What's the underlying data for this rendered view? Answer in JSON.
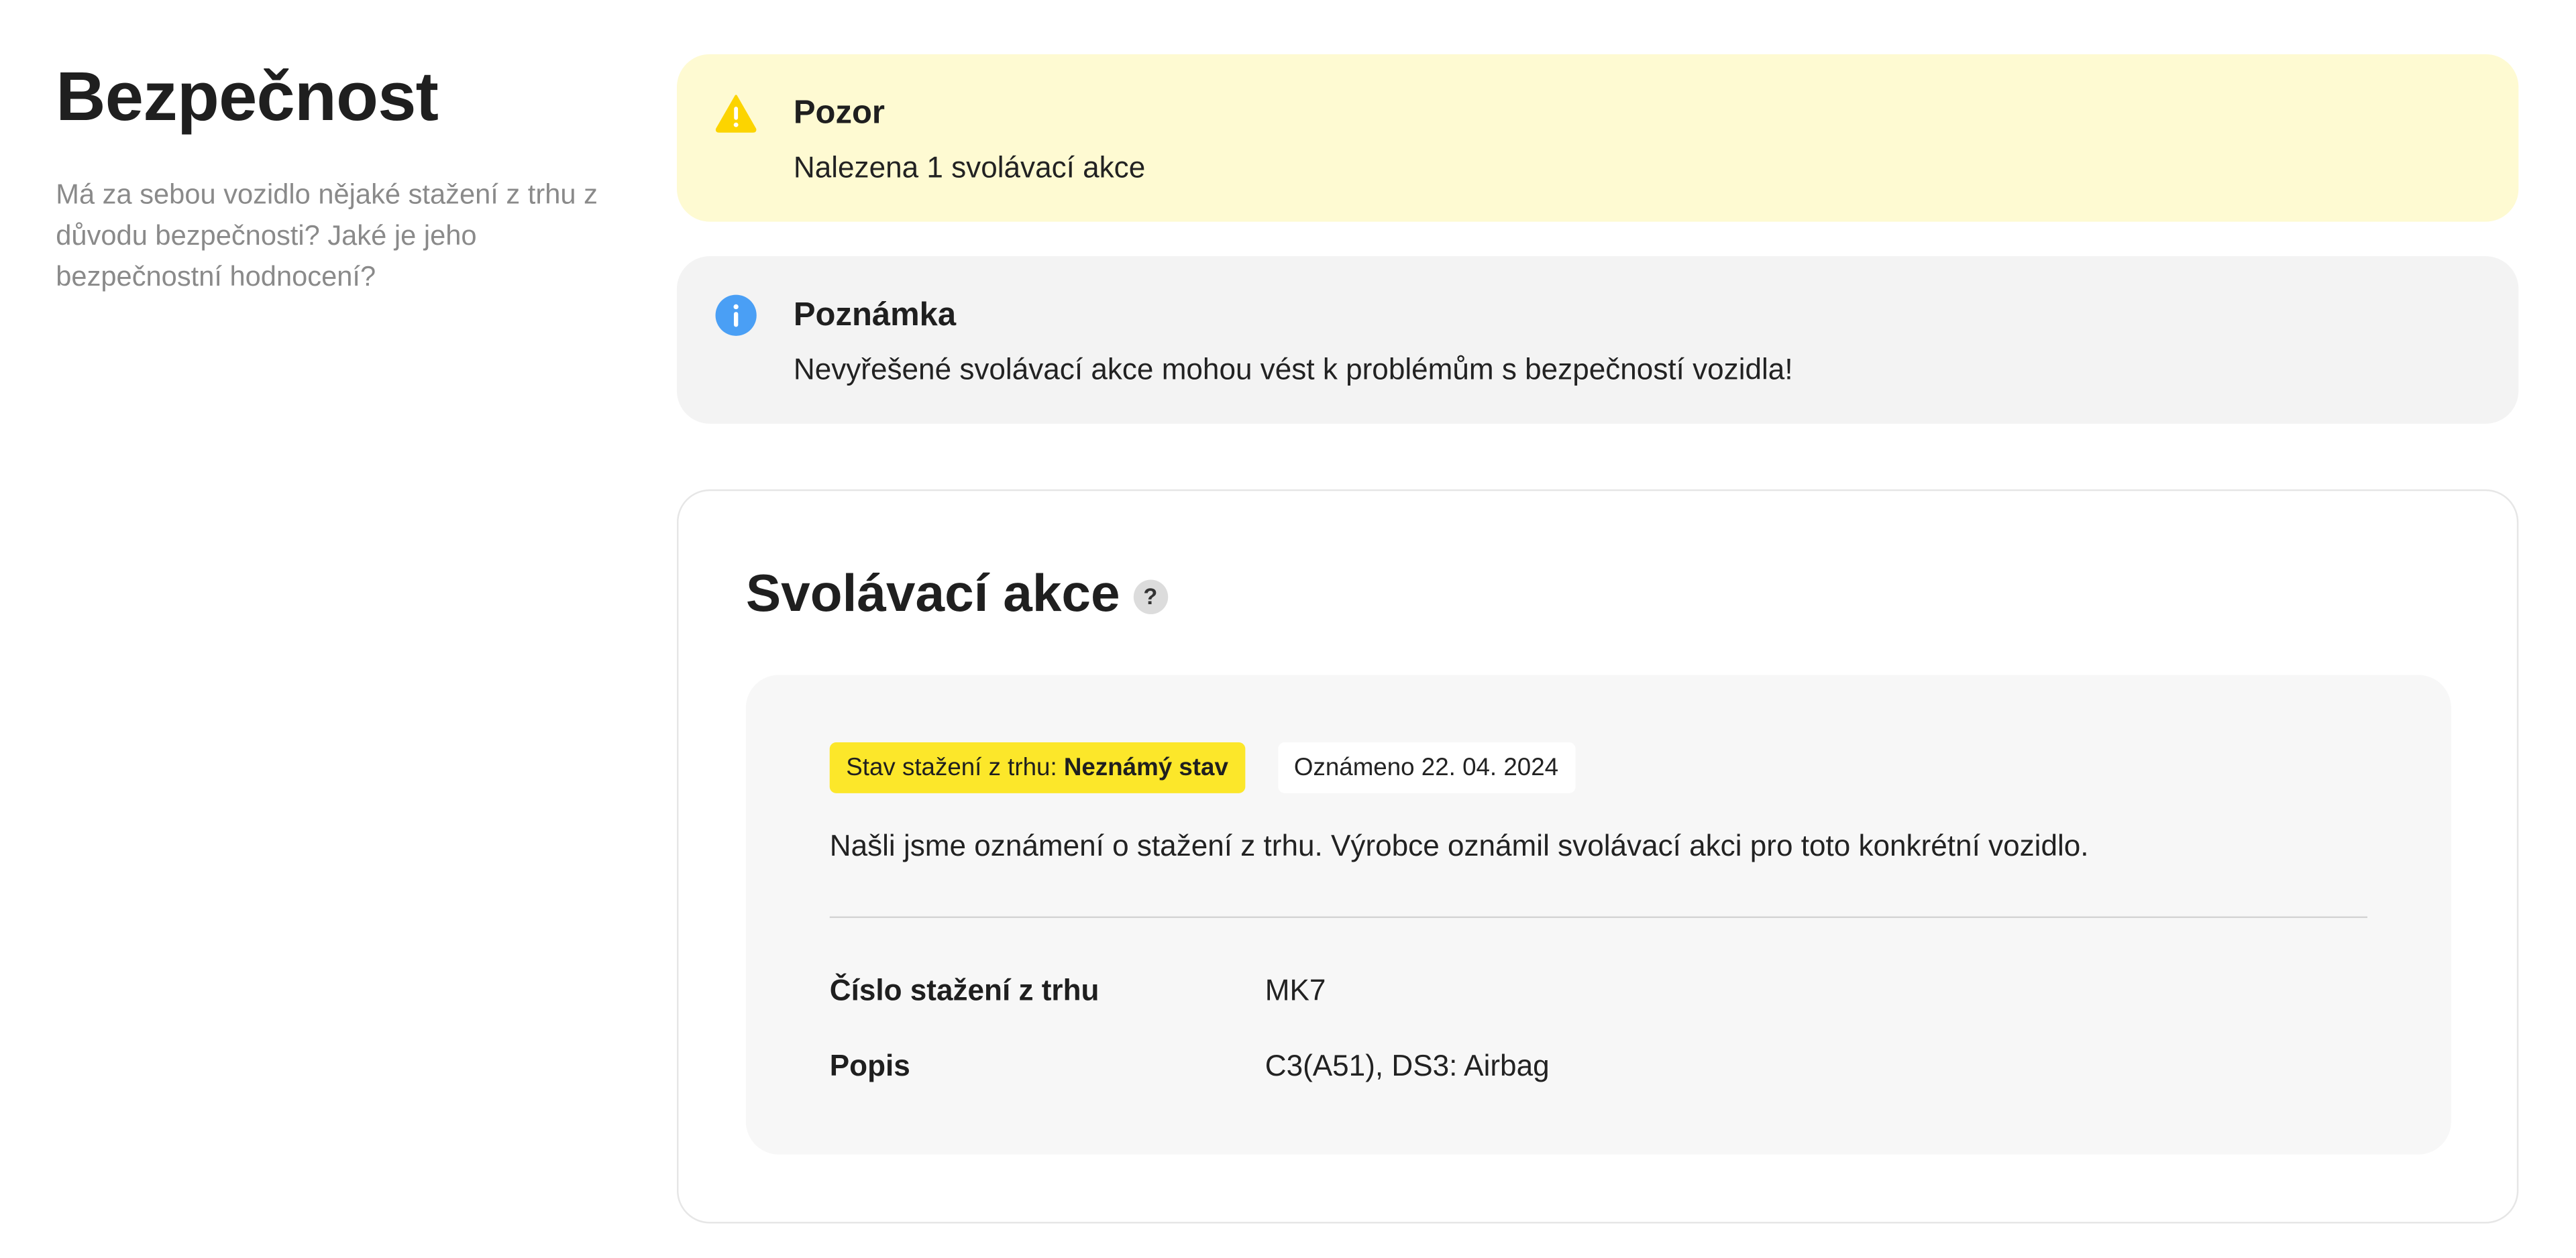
{
  "page": {
    "title": "Bezpečnost",
    "description": "Má za sebou vozidlo nějaké stažení z trhu z důvodu bezpečnosti? Jaké je jeho bezpečnostní hodnocení?"
  },
  "alerts": {
    "warning": {
      "icon": "warning-triangle-icon",
      "color": "#fcd400",
      "title": "Pozor",
      "text": "Nalezena 1 svolávací akce"
    },
    "note": {
      "icon": "info-circle-icon",
      "color": "#4a9ff5",
      "title": "Poznámka",
      "text": "Nevyřešené svolávací akce mohou vést k problémům s bezpečností vozidla!"
    }
  },
  "recalls": {
    "title": "Svolávací akce",
    "help_icon": "question-mark-icon",
    "help_glyph": "?",
    "items": [
      {
        "status_label": "Stav stažení z trhu:",
        "status_value": "Neznámý stav",
        "announced": "Oznámeno 22. 04. 2024",
        "text": "Našli jsme oznámení o stažení z trhu. Výrobce oznámil svolávací akci pro toto konkrétní vozidlo.",
        "details": [
          {
            "label": "Číslo stažení z trhu",
            "value": "MK7"
          },
          {
            "label": "Popis",
            "value": "C3(A51), DS3: Airbag"
          }
        ]
      }
    ]
  },
  "colors": {
    "warning_bg": "#fefad2",
    "note_bg": "#f3f3f3",
    "status_badge": "#fce72a"
  }
}
